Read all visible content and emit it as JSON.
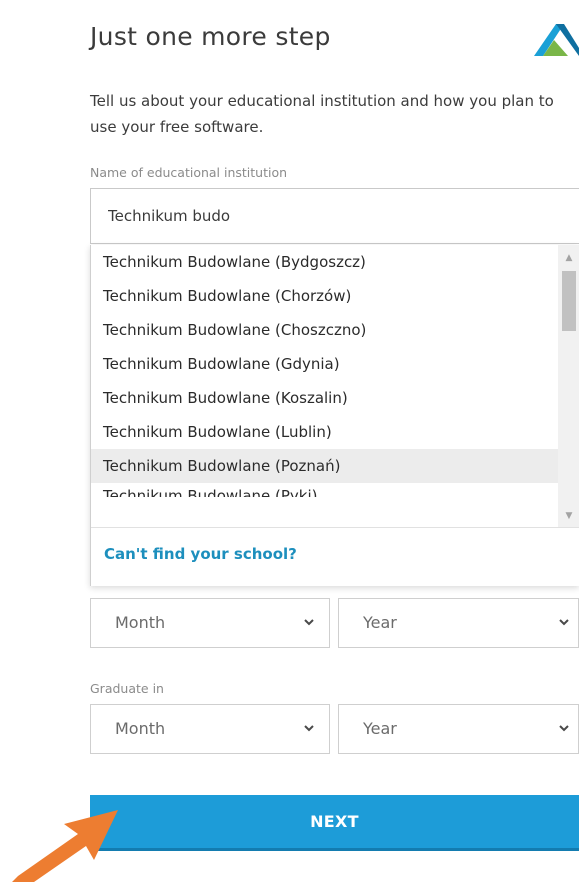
{
  "header": {
    "title": "Just one more step",
    "logo_icon": "autodesk-logo-icon"
  },
  "intro": {
    "text": "Tell us about your educational institution and how you plan to use your free software."
  },
  "institution": {
    "label": "Name of educational institution",
    "value": "Technikum budo",
    "suggestions": [
      "Technikum Budowlane (Bydgoszcz)",
      "Technikum Budowlane (Chorzów)",
      "Technikum Budowlane (Choszczno)",
      "Technikum Budowlane (Gdynia)",
      "Technikum Budowlane (Koszalin)",
      "Technikum Budowlane (Lublin)",
      "Technikum Budowlane (Poznań)",
      "Technikum Budowlane (Pyki)"
    ],
    "highlighted_index": 6,
    "cant_find_label": "Can't find your school?"
  },
  "enrolled": {
    "month_value": "Month",
    "year_value": "Year"
  },
  "graduate": {
    "label": "Graduate in",
    "month_value": "Month",
    "year_value": "Year"
  },
  "actions": {
    "next_label": "NEXT"
  },
  "colors": {
    "accent": "#1d9cd8",
    "link": "#1d8fbd",
    "annotation_arrow": "#ed7d31",
    "logo_blue": "#1aa0d6",
    "logo_green": "#7ab648"
  }
}
